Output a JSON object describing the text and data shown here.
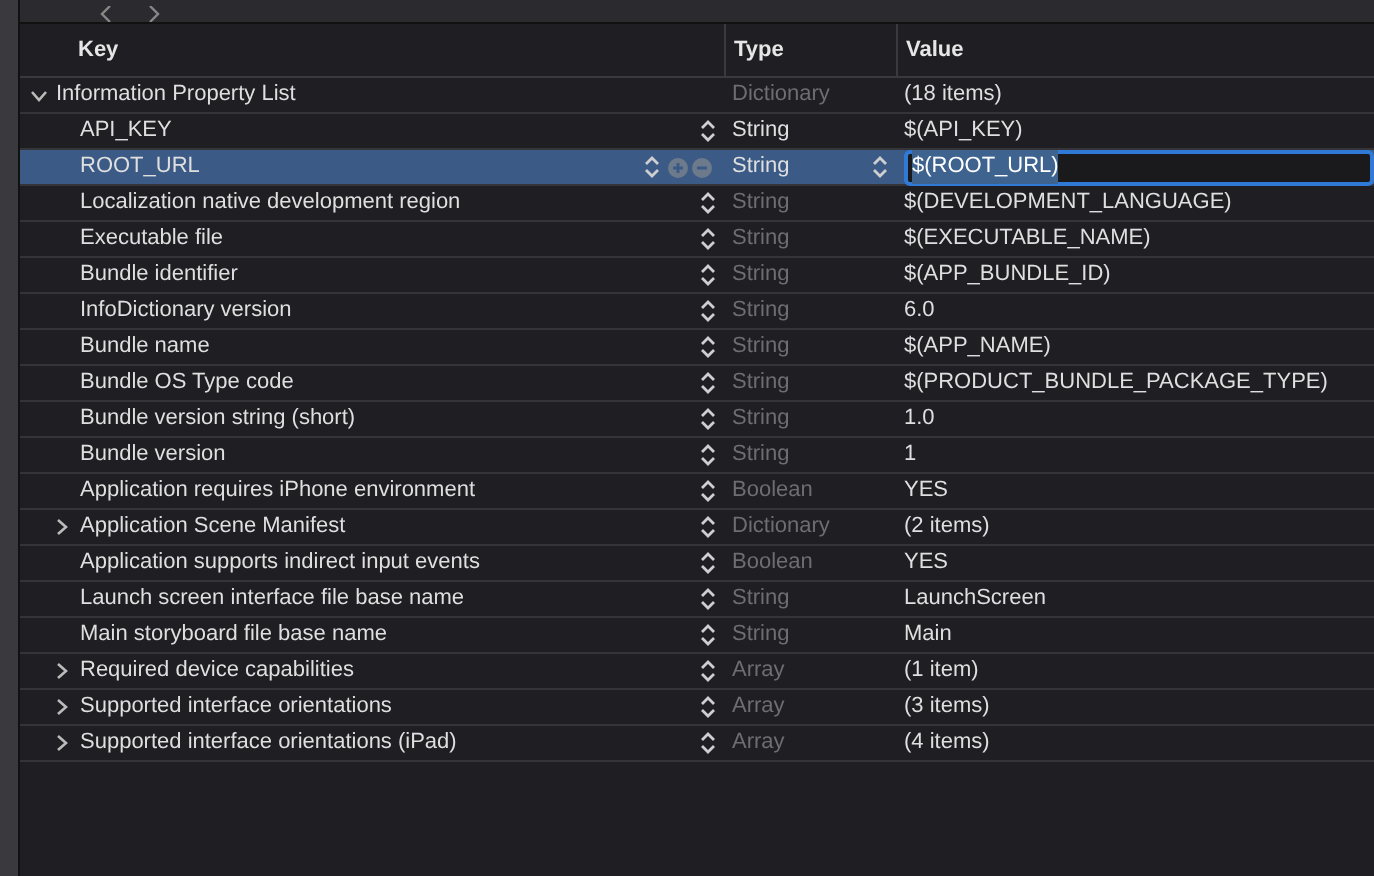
{
  "columns": [
    "Key",
    "Type",
    "Value"
  ],
  "root": {
    "key": "Information Property List",
    "type": "Dictionary",
    "value": "(18 items)",
    "expanded": true,
    "children": [
      {
        "key": "API_KEY",
        "type": "String",
        "value": "$(API_KEY)",
        "editable": true,
        "selected": false
      },
      {
        "key": "ROOT_URL",
        "type": "String",
        "value": "$(ROOT_URL)",
        "editable": true,
        "selected": true
      },
      {
        "key": "Localization native development region",
        "type": "String",
        "value": "$(DEVELOPMENT_LANGUAGE)",
        "editable": false,
        "selected": false
      },
      {
        "key": "Executable file",
        "type": "String",
        "value": "$(EXECUTABLE_NAME)",
        "editable": false,
        "selected": false
      },
      {
        "key": "Bundle identifier",
        "type": "String",
        "value": "$(APP_BUNDLE_ID)",
        "editable": false,
        "selected": false
      },
      {
        "key": "InfoDictionary version",
        "type": "String",
        "value": "6.0",
        "editable": false,
        "selected": false
      },
      {
        "key": "Bundle name",
        "type": "String",
        "value": "$(APP_NAME)",
        "editable": false,
        "selected": false
      },
      {
        "key": "Bundle OS Type code",
        "type": "String",
        "value": "$(PRODUCT_BUNDLE_PACKAGE_TYPE)",
        "editable": false,
        "selected": false
      },
      {
        "key": "Bundle version string (short)",
        "type": "String",
        "value": "1.0",
        "editable": false,
        "selected": false
      },
      {
        "key": "Bundle version",
        "type": "String",
        "value": "1",
        "editable": false,
        "selected": false
      },
      {
        "key": "Application requires iPhone environment",
        "type": "Boolean",
        "value": "YES",
        "editable": false,
        "selected": false
      },
      {
        "key": "Application Scene Manifest",
        "type": "Dictionary",
        "value": "(2 items)",
        "editable": false,
        "selected": false,
        "expanded": false
      },
      {
        "key": "Application supports indirect input events",
        "type": "Boolean",
        "value": "YES",
        "editable": false,
        "selected": false
      },
      {
        "key": "Launch screen interface file base name",
        "type": "String",
        "value": "LaunchScreen",
        "editable": false,
        "selected": false
      },
      {
        "key": "Main storyboard file base name",
        "type": "String",
        "value": "Main",
        "editable": false,
        "selected": false
      },
      {
        "key": "Required device capabilities",
        "type": "Array",
        "value": "(1 item)",
        "editable": false,
        "selected": false,
        "expanded": false
      },
      {
        "key": "Supported interface orientations",
        "type": "Array",
        "value": "(3 items)",
        "editable": false,
        "selected": false,
        "expanded": false
      },
      {
        "key": "Supported interface orientations (iPad)",
        "type": "Array",
        "value": "(4 items)",
        "editable": false,
        "selected": false,
        "expanded": false
      }
    ]
  }
}
